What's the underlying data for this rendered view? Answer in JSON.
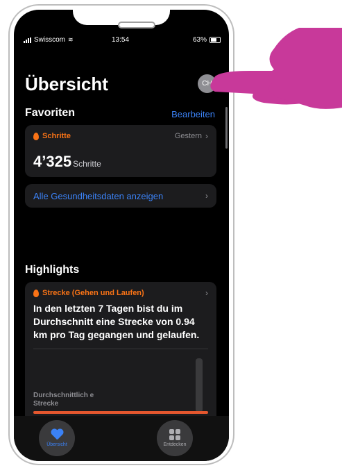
{
  "status_bar": {
    "carrier": "Swisscom",
    "time": "13:54",
    "battery": "63%"
  },
  "header": {
    "title": "Übersicht",
    "avatar_initials": "CH"
  },
  "favorites": {
    "heading": "Favoriten",
    "edit_label": "Bearbeiten",
    "steps_card": {
      "label": "Schritte",
      "date": "Gestern",
      "value": "4’325",
      "unit": "Schritte"
    },
    "all_data_label": "Alle Gesundheitsdaten anzeigen"
  },
  "highlights": {
    "heading": "Highlights",
    "card": {
      "label": "Strecke (Gehen und Laufen)",
      "text": "In den letzten 7 Tagen bist du im Durchschnitt eine Strecke von 0.94 km pro Tag gegangen und gelaufen.",
      "avg_label": "Durchschnittlich e Strecke"
    }
  },
  "tabbar": {
    "overview_label": "Übersicht",
    "discover_label": "Entdecken"
  },
  "colors": {
    "accent_blue": "#3b82f6",
    "accent_orange": "#f97316",
    "hand": "#c8399a"
  },
  "icons": [
    "flame-icon",
    "chevron-right-icon",
    "heart-icon",
    "grid-icon",
    "wifi-icon",
    "battery-icon",
    "hand-pointer-icon"
  ]
}
